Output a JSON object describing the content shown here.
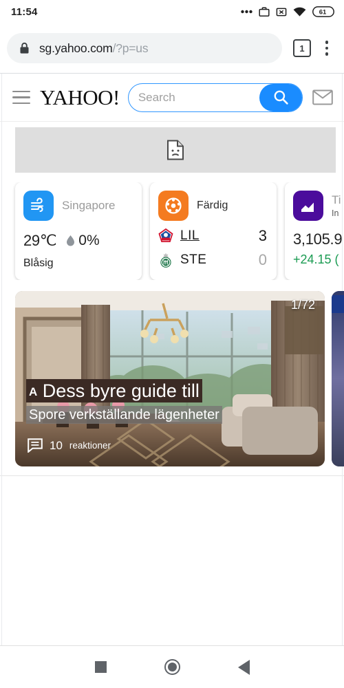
{
  "status": {
    "time": "11:54",
    "battery_level": "61",
    "icons": [
      "more-dots-icon",
      "work-profile-icon",
      "no-sim-icon",
      "wifi-icon",
      "battery-icon"
    ]
  },
  "browser": {
    "url_host": "sg.yahoo.com",
    "url_path": "/?p=us",
    "lock_icon": "lock-icon",
    "tab_count": "1",
    "menu_icon": "overflow-menu-icon"
  },
  "site_header": {
    "logo": "YAHOO!",
    "menu_icon": "hamburger-icon",
    "search_placeholder": "Search",
    "search_value": "",
    "search_button_icon": "search-icon",
    "mail_icon": "mail-icon"
  },
  "placeholder": {
    "icon": "broken-image-icon"
  },
  "cards": {
    "weather": {
      "icon": "wind-icon",
      "location": "Singapore",
      "temperature": "29℃",
      "humidity": "0%",
      "humidity_icon": "droplet-icon",
      "condition": "Blåsig",
      "accent": "#2196f3"
    },
    "sports": {
      "icon": "soccer-ball-icon",
      "status": "Färdig",
      "rows": [
        {
          "crest": "lille-crest-icon",
          "team": "LIL",
          "score": "3",
          "winner": true
        },
        {
          "crest": "saint-etienne-crest-icon",
          "team": "STE",
          "score": "0",
          "winner": false
        }
      ],
      "accent": "#f47b20"
    },
    "finance": {
      "icon": "trend-chart-icon",
      "title": "Ti",
      "subtitle": "In",
      "value": "3,105.9",
      "change": "+24.15 (",
      "change_color": "#1a9b52",
      "accent": "#4b0c9c"
    }
  },
  "article": {
    "counter": "1/72",
    "badge": "A",
    "headline": "Dess byre guide till",
    "subheadline": "Spore verkställande lägenheter",
    "reactions_count": "10",
    "reactions_label": "reaktioner",
    "reactions_icon": "comment-icon"
  },
  "navbar": {
    "recents": "recents-square-icon",
    "home": "home-circle-icon",
    "back": "back-triangle-icon"
  }
}
